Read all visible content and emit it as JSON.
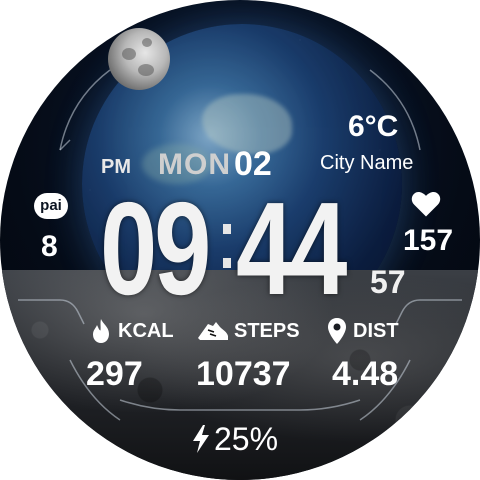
{
  "watchface": {
    "ampm": "PM",
    "day": "MON",
    "date": "02",
    "time": {
      "hours": "09",
      "minutes": "44",
      "seconds": "57"
    },
    "weather": {
      "temperature": "6°C",
      "city": "City Name"
    },
    "pai": {
      "label": "pai",
      "value": "8"
    },
    "heart_rate": {
      "icon": "heart-icon",
      "value": "157"
    },
    "stats": [
      {
        "icon": "flame-icon",
        "label": "KCAL",
        "value": "297"
      },
      {
        "icon": "shoe-icon",
        "label": "STEPS",
        "value": "10737"
      },
      {
        "icon": "location-pin-icon",
        "label": "DIST",
        "value": "4.48"
      }
    ],
    "battery": {
      "icon": "lightning-icon",
      "value": "25%"
    }
  }
}
